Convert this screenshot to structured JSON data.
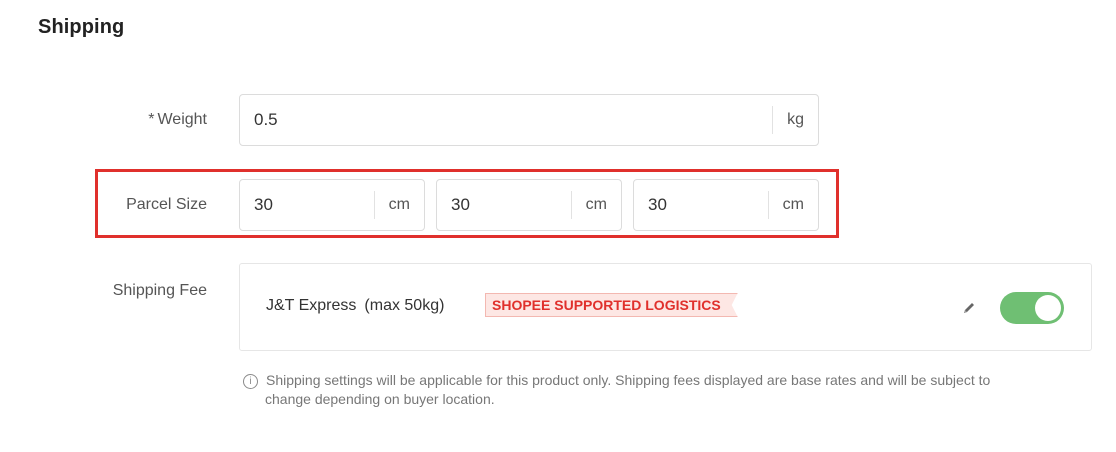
{
  "section": {
    "title": "Shipping"
  },
  "weight": {
    "label": "Weight",
    "required_mark": "*",
    "value": "0.5",
    "unit": "kg"
  },
  "parcel_size": {
    "label": "Parcel Size",
    "dimensions": [
      {
        "value": "30",
        "unit": "cm"
      },
      {
        "value": "30",
        "unit": "cm"
      },
      {
        "value": "30",
        "unit": "cm"
      }
    ]
  },
  "shipping_fee": {
    "label": "Shipping Fee",
    "courier_name": "J&T Express",
    "courier_limit": "(max 50kg)",
    "tag": "SHOPEE SUPPORTED LOGISTICS",
    "edit_icon": "pencil-icon",
    "enabled": true
  },
  "note": {
    "icon": "info-icon",
    "line1": "Shipping settings will be applicable for this product only. Shipping fees displayed are base rates and will be subject to",
    "line2": "change depending on buyer location."
  },
  "colors": {
    "highlight": "#e0302c",
    "toggle_on": "#6fbf73",
    "tag_text": "#e0302c",
    "tag_bg": "#fde7e4"
  }
}
